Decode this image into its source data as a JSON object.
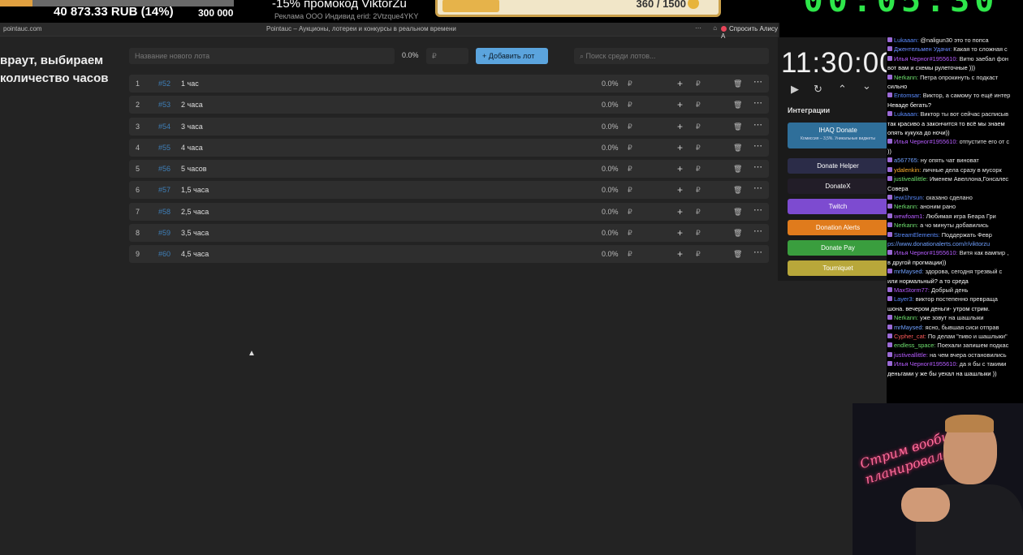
{
  "overlay": {
    "left_label": "",
    "rub_amount": "40 873.33 RUB (14%)",
    "goal": "300 000",
    "promo": "-15% промокод ViktorZu",
    "ad_text": "Реклама ООО Индивид erid: 2Vtzque4YKY",
    "card_value": "360 / 1500",
    "top_clock": "00:05:30"
  },
  "browser": {
    "url": "pointauc.com",
    "tab_title": "Pointauc – Аукционы, лотереи и конкурсы в реальном времени",
    "alice_label": "Спросить Алису А"
  },
  "app": {
    "caption": "враут, выбираем количество часов",
    "name_placeholder": "Название нового лота",
    "percent": "0.0%",
    "rub_placeholder": "₽",
    "add_button": "Добавить лот",
    "search_placeholder": "Поиск среди лотов...",
    "lots": [
      {
        "idx": "1",
        "num": "#52",
        "name": "1 час",
        "pct": "0.0%"
      },
      {
        "idx": "2",
        "num": "#53",
        "name": "2 часа",
        "pct": "0.0%"
      },
      {
        "idx": "3",
        "num": "#54",
        "name": "3 часа",
        "pct": "0.0%"
      },
      {
        "idx": "4",
        "num": "#55",
        "name": "4 часа",
        "pct": "0.0%"
      },
      {
        "idx": "5",
        "num": "#56",
        "name": "5 часов",
        "pct": "0.0%"
      },
      {
        "idx": "6",
        "num": "#57",
        "name": "1,5 часа",
        "pct": "0.0%"
      },
      {
        "idx": "7",
        "num": "#58",
        "name": "2,5 часа",
        "pct": "0.0%"
      },
      {
        "idx": "8",
        "num": "#59",
        "name": "3,5 часа",
        "pct": "0.0%"
      },
      {
        "idx": "9",
        "num": "#60",
        "name": "4,5 часа",
        "pct": "0.0%"
      }
    ]
  },
  "panel": {
    "timer": "11:30:00",
    "integrations_title": "Интеграции",
    "integrations": [
      {
        "label": "IHAQ Donate",
        "sub": "Комиссия – 3,5%. Уникальные виджеты",
        "color": "#2f6f9a"
      },
      {
        "label": "Donate Helper",
        "color": "#2b2c48"
      },
      {
        "label": "DonateX",
        "color": "#221d28"
      },
      {
        "label": "Twitch",
        "color": "#7d4bd0"
      },
      {
        "label": "Donation Alerts",
        "color": "#e07b1c"
      },
      {
        "label": "Donate Pay",
        "color": "#3a9e3e"
      },
      {
        "label": "Tourniquet",
        "color": "#b8a73a"
      }
    ]
  },
  "chat": [
    {
      "user": "Lukaaan:",
      "color": "#5b8cff",
      "text": "@naligun30 это то попса"
    },
    {
      "user": "Джентельмен Удачи:",
      "color": "#6a8cff",
      "text": "Какая то сложная с"
    },
    {
      "user": "Илья Черног#1955610:",
      "color": "#b65cff",
      "text": "Витю заебал фон"
    },
    {
      "user": "",
      "color": "#fff",
      "text": "вот вам и схемы рулеточные )))"
    },
    {
      "user": "Nerkann:",
      "color": "#6fe06f",
      "text": "Петра опрокинуть с подкаст"
    },
    {
      "user": "",
      "color": "#fff",
      "text": "сильно"
    },
    {
      "user": "Entomsar:",
      "color": "#5b8cff",
      "text": "Виктор, а самому то ещё интер"
    },
    {
      "user": "",
      "color": "#fff",
      "text": "Неваде бегать?"
    },
    {
      "user": "Lukaaan:",
      "color": "#5b8cff",
      "text": "Виктор ты вот сейчас расписыв"
    },
    {
      "user": "",
      "color": "#fff",
      "text": "так красиво а закончится то всё мы знаем"
    },
    {
      "user": "",
      "color": "#fff",
      "text": "опять кукуха до ночи))"
    },
    {
      "user": "Илья Черног#1955610:",
      "color": "#b65cff",
      "text": "отпустите его от с"
    },
    {
      "user": "",
      "color": "#fff",
      "text": "))"
    },
    {
      "user": "a567765:",
      "color": "#6fa0ff",
      "text": "ну опять чат виноват"
    },
    {
      "user": "ydalenkin:",
      "color": "#ffb030",
      "text": "личные дела сразу в мусорк"
    },
    {
      "user": "justiveallittle:",
      "color": "#6fe06f",
      "text": "Именем Авеллона,Гонсалес"
    },
    {
      "user": "",
      "color": "#fff",
      "text": "Совера"
    },
    {
      "user": "lewi1hrsun:",
      "color": "#5b8cff",
      "text": "сказано сделано"
    },
    {
      "user": "Nerkann:",
      "color": "#6fe06f",
      "text": "аноним рано"
    },
    {
      "user": "wewfoam1:",
      "color": "#b65cff",
      "text": "Любимая игра Беара Гри"
    },
    {
      "user": "Nerkann:",
      "color": "#6fe06f",
      "text": "а чо минуты добавились"
    },
    {
      "user": "StreamElements:",
      "color": "#5b8cff",
      "text": "Поддержать Февр"
    },
    {
      "user": "",
      "color": "#6fa0ff",
      "text": "ps://www.donationalerts.com/r/viktorzu"
    },
    {
      "user": "Илья Черног#1955610:",
      "color": "#b65cff",
      "text": "Витя как вампир ,"
    },
    {
      "user": "",
      "color": "#fff",
      "text": "в другой прогмации))"
    },
    {
      "user": "mrMaysed:",
      "color": "#6fa0ff",
      "text": "здорова, сегодня трезвый с"
    },
    {
      "user": "",
      "color": "#fff",
      "text": "или нормальный? а то среда"
    },
    {
      "user": "MaxStorm77:",
      "color": "#b65cff",
      "text": "Добрый день"
    },
    {
      "user": "Layer3:",
      "color": "#5b8cff",
      "text": "виктор постепенно превраща"
    },
    {
      "user": "",
      "color": "#fff",
      "text": "шона. вечером деньги- утром стрим."
    },
    {
      "user": "Nerkann:",
      "color": "#6fe06f",
      "text": "уже зовут на шашлыки"
    },
    {
      "user": "mrMaysed:",
      "color": "#6fa0ff",
      "text": "ясно, бывшая сиси отправ"
    },
    {
      "user": "",
      "color": "#fff",
      "text": ""
    },
    {
      "user": "Cypher_cat:",
      "color": "#ff5a5a",
      "text": "По делам \"пиво и шашлыки\""
    },
    {
      "user": "endless_space:",
      "color": "#6fe06f",
      "text": "Поехали запишем подкас"
    },
    {
      "user": "justiveallittle:",
      "color": "#b65cff",
      "text": "на чем вчера остановились"
    },
    {
      "user": "Илья Черног#1955610:",
      "color": "#b65cff",
      "text": "да я бы с такими"
    },
    {
      "user": "",
      "color": "#fff",
      "text": "деньгами у же бы уехал на шашлыки ))"
    }
  ],
  "webcam": {
    "neon_text": "Стрим вообще не планировался"
  }
}
